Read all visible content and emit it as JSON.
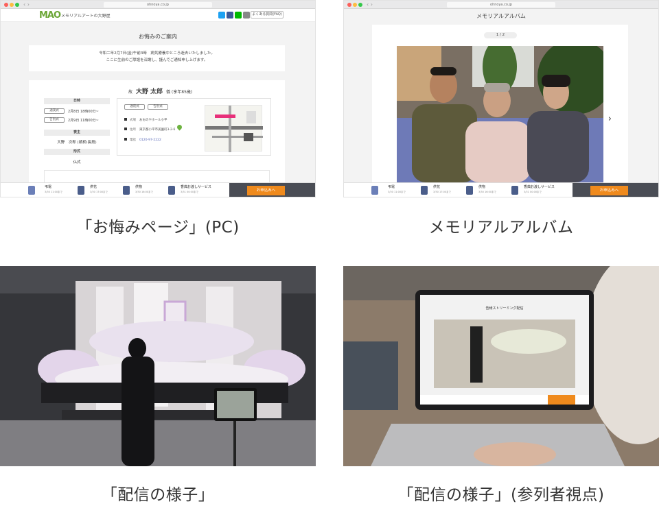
{
  "panel1": {
    "url": "ohnoya.co.jp",
    "logo": "MAO",
    "logo_sub": "メモリアルアートの大野屋",
    "faq": "よくある質問(FAQ)",
    "page_title": "お悔みのご案内",
    "notice_line1": "令和二年2月7日(金)午前3時　病気療養中ところ逝去いたしました。",
    "notice_line2": "ここに生前のご厚誼を深謝し、謹んでご通知申し上げます。",
    "deceased_prefix": "故",
    "deceased_name": "大野 太郎",
    "deceased_suffix": "儀 (享年85歳)",
    "datetime_label": "日時",
    "wake_label": "通夜式",
    "wake_time": "2月8日 18時00分~",
    "funeral_label": "告別式",
    "funeral_time": "2月9日 11時00分~",
    "chief_label": "喪主",
    "chief_name": "大野　次郎 (続柄:長男)",
    "style_label": "形式",
    "style_value": "仏式",
    "tab_wake": "通夜式",
    "tab_funeral": "告別式",
    "venue_key": "式場",
    "venue_value": "おおのやホール小平",
    "address_key": "住所",
    "address_value": "東京都小平市美園町3-2-6",
    "phone_key": "電話",
    "phone_value": "0120-97-2222"
  },
  "offer_bar": {
    "items": [
      {
        "label": "弔電",
        "deadline": "3/30 11:00まで"
      },
      {
        "label": "供花",
        "deadline": "3/30 17:00まで"
      },
      {
        "label": "供物",
        "deadline": "3/30 16:00まで"
      },
      {
        "label": "香典お渡しサービス",
        "deadline": "3/31 00:00まで"
      }
    ],
    "apply": "お申込みへ"
  },
  "panel2": {
    "url": "ohnoya.co.jp",
    "title": "メモリアルアルバム",
    "counter": "1 / 2",
    "next": "›"
  },
  "captions": {
    "c1": "「お悔みページ」(PC)",
    "c2": "メモリアルアルバム",
    "c3": "「配信の様子」",
    "c4": "「配信の様子」(参列者視点)"
  },
  "panel4": {
    "screen_title": "告様ストリーミング配信"
  },
  "colors": {
    "accent_orange": "#ef8a1d",
    "logo_green": "#6aa535",
    "bar_dark": "#4a4d55"
  }
}
